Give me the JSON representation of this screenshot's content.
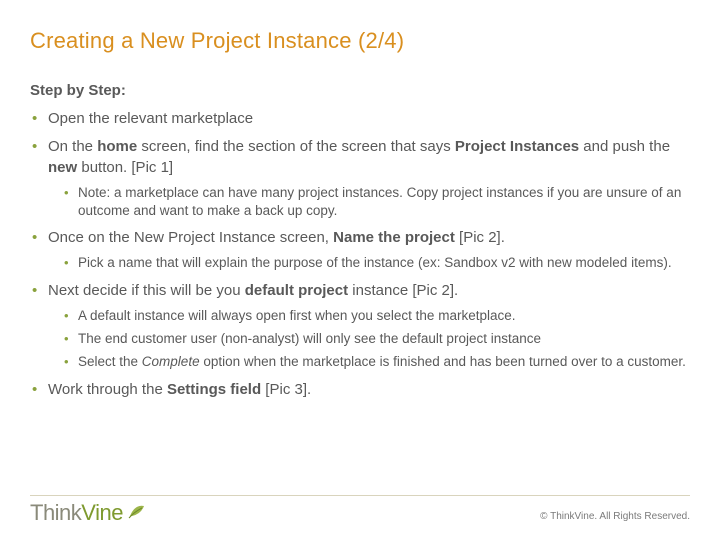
{
  "title": "Creating a New Project Instance (2/4)",
  "step_head": "Step by Step:",
  "b1_a": "Open the relevant marketplace",
  "b2_a": "On the ",
  "b2_b": "home",
  "b2_c": " screen, find the section of the screen that says ",
  "b2_d": "Project Instances",
  "b2_e": " and push the ",
  "b2_f": "new",
  "b2_g": " button.  [Pic 1]",
  "b2_sub1": "Note: a marketplace can have many project instances.  Copy project instances if you are unsure of an outcome and want to make a back up copy.",
  "b3_a": "Once on the New Project Instance screen, ",
  "b3_b": "Name the project",
  "b3_c": " [Pic 2].",
  "b3_sub1": "Pick a name that will explain the purpose of the instance (ex: Sandbox v2 with new modeled items).",
  "b4_a": "Next decide if this will be you ",
  "b4_b": "default project",
  "b4_c": " instance [Pic 2].",
  "b4_sub1": "A default instance will always open first when you select the marketplace.",
  "b4_sub2": "The end customer user (non-analyst) will only see the default project instance",
  "b4_sub3_a": "Select the ",
  "b4_sub3_b": "Complete",
  "b4_sub3_c": " option when the marketplace is finished and has been turned over to a customer.",
  "b5_a": "Work through the ",
  "b5_b": "Settings field",
  "b5_c": " [Pic 3].",
  "logo_think": "Think",
  "logo_vine": "Vine",
  "copyright": "© ThinkVine.  All Rights Reserved."
}
